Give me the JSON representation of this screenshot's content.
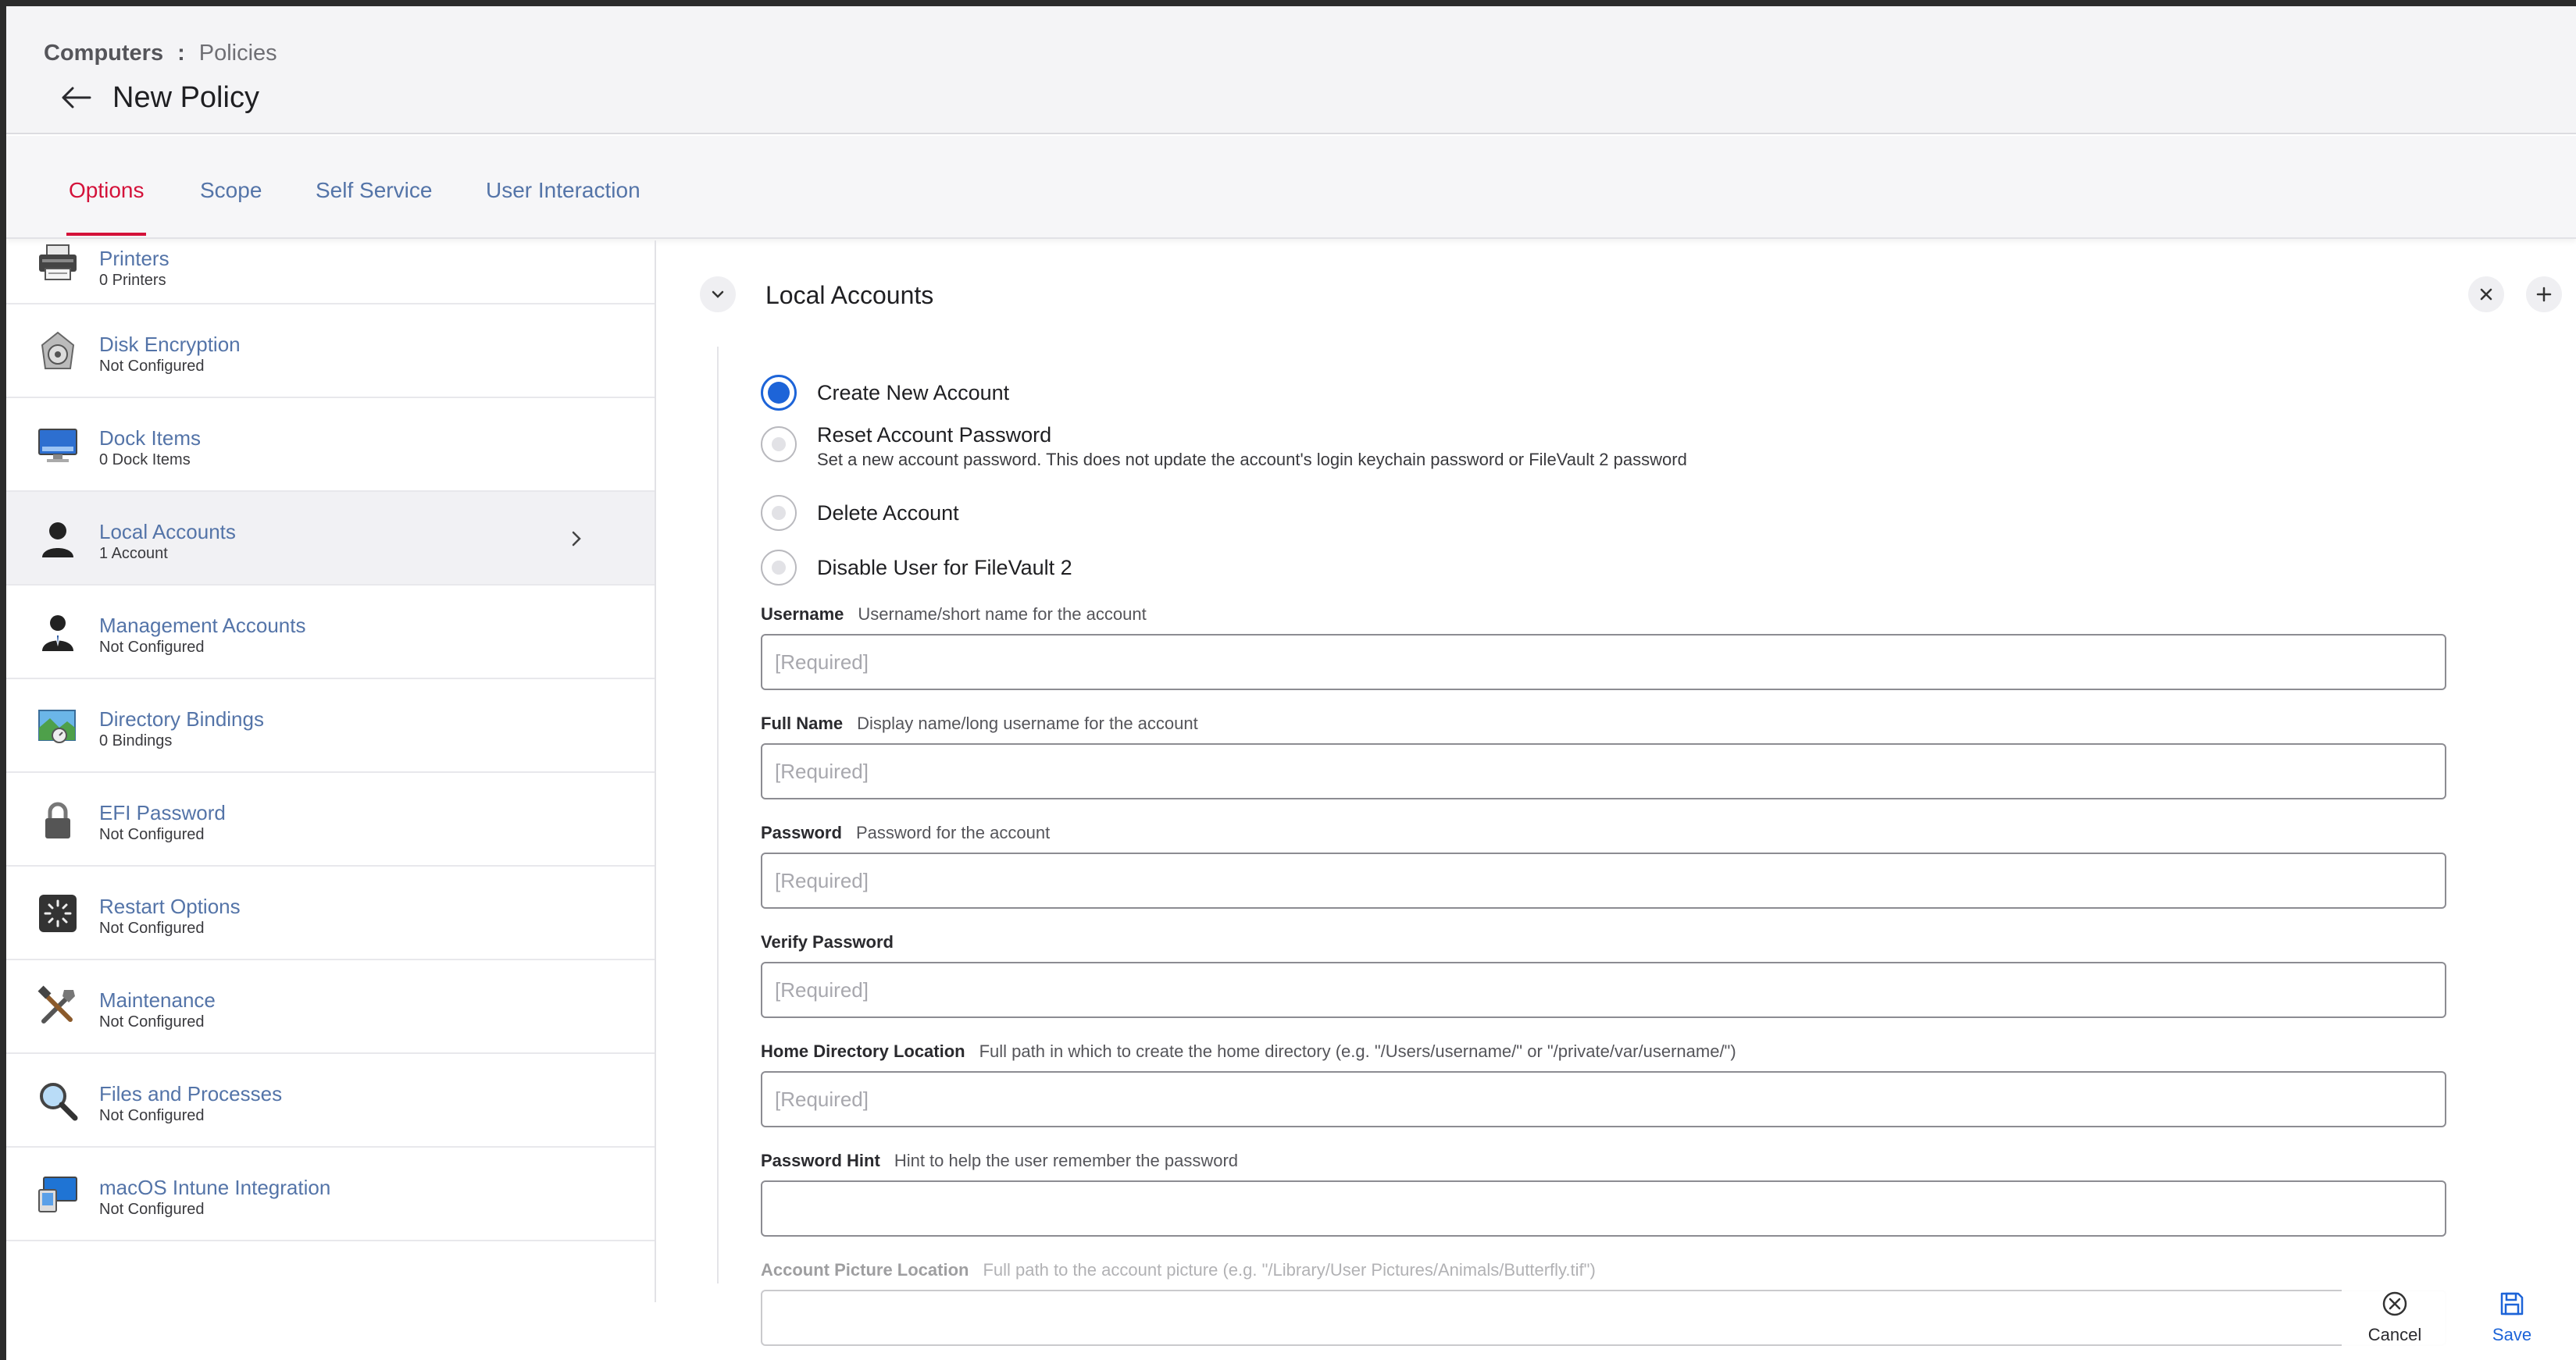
{
  "breadcrumb": {
    "root": "Computers",
    "separator": ":",
    "current": "Policies"
  },
  "page": {
    "title": "New Policy"
  },
  "tabs": [
    {
      "label": "Options",
      "active": true
    },
    {
      "label": "Scope",
      "active": false
    },
    {
      "label": "Self Service",
      "active": false
    },
    {
      "label": "User Interaction",
      "active": false
    }
  ],
  "sidebar": {
    "items": [
      {
        "name": "Printers",
        "status": "0 Printers",
        "icon": "printer-icon"
      },
      {
        "name": "Disk Encryption",
        "status": "Not Configured",
        "icon": "disk-encryption-icon"
      },
      {
        "name": "Dock Items",
        "status": "0 Dock Items",
        "icon": "dock-icon"
      },
      {
        "name": "Local Accounts",
        "status": "1 Account",
        "icon": "user-icon",
        "active": true
      },
      {
        "name": "Management Accounts",
        "status": "Not Configured",
        "icon": "manager-icon"
      },
      {
        "name": "Directory Bindings",
        "status": "0 Bindings",
        "icon": "directory-icon"
      },
      {
        "name": "EFI Password",
        "status": "Not Configured",
        "icon": "lock-icon"
      },
      {
        "name": "Restart Options",
        "status": "Not Configured",
        "icon": "restart-icon"
      },
      {
        "name": "Maintenance",
        "status": "Not Configured",
        "icon": "tools-icon"
      },
      {
        "name": "Files and Processes",
        "status": "Not Configured",
        "icon": "magnifier-icon"
      },
      {
        "name": "macOS Intune Integration",
        "status": "Not Configured",
        "icon": "intune-icon"
      }
    ]
  },
  "section": {
    "title": "Local Accounts",
    "options": [
      {
        "label": "Create New Account",
        "description": "",
        "selected": true
      },
      {
        "label": "Reset Account Password",
        "description": "Set a new account password. This does not update the account's login keychain password or FileVault 2 password",
        "selected": false
      },
      {
        "label": "Delete Account",
        "description": "",
        "selected": false
      },
      {
        "label": "Disable User for FileVault 2",
        "description": "",
        "selected": false
      }
    ],
    "fields": [
      {
        "label": "Username",
        "help": "Username/short name for the account",
        "placeholder": "[Required]",
        "value": ""
      },
      {
        "label": "Full Name",
        "help": "Display name/long username for the account",
        "placeholder": "[Required]",
        "value": ""
      },
      {
        "label": "Password",
        "help": "Password for the account",
        "placeholder": "[Required]",
        "value": ""
      },
      {
        "label": "Verify Password",
        "help": "",
        "placeholder": "[Required]",
        "value": ""
      },
      {
        "label": "Home Directory Location",
        "help": "Full path in which to create the home directory (e.g. \"/Users/username/\" or \"/private/var/username/\")",
        "placeholder": "[Required]",
        "value": ""
      },
      {
        "label": "Password Hint",
        "help": "Hint to help the user remember the password",
        "placeholder": "",
        "value": ""
      },
      {
        "label": "Account Picture Location",
        "help": "Full path to the account picture (e.g. \"/Library/User Pictures/Animals/Butterfly.tif\")",
        "placeholder": "",
        "value": ""
      }
    ]
  },
  "actions": {
    "cancel": "Cancel",
    "save": "Save"
  },
  "colors": {
    "accent_red": "#d4123a",
    "link_blue": "#5474a8",
    "radio_blue": "#1d64d8",
    "save_blue": "#1d64d8"
  }
}
